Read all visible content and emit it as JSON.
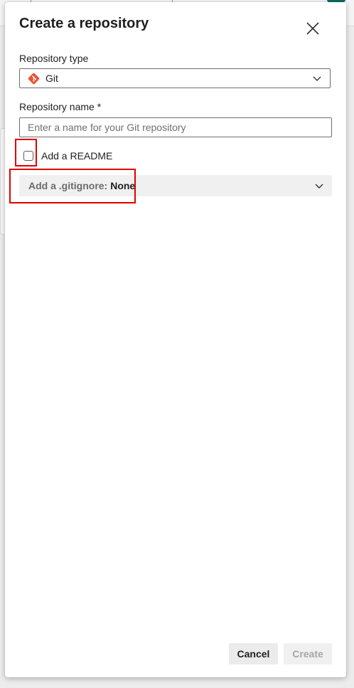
{
  "dialog": {
    "title": "Create a repository",
    "close_icon": "close-icon"
  },
  "repository_type": {
    "label": "Repository type",
    "selected": "Git",
    "icon": "git-icon"
  },
  "repository_name": {
    "label": "Repository name *",
    "value": "",
    "placeholder": "Enter a name for your Git repository"
  },
  "readme": {
    "label": "Add a README",
    "checked": false
  },
  "gitignore": {
    "label": "Add a .gitignore:",
    "value": "None"
  },
  "footer": {
    "cancel_label": "Cancel",
    "create_label": "Create"
  },
  "colors": {
    "highlight": "#e00000",
    "git_brand": "#f05133",
    "disabled_text": "#a6a6a6"
  }
}
